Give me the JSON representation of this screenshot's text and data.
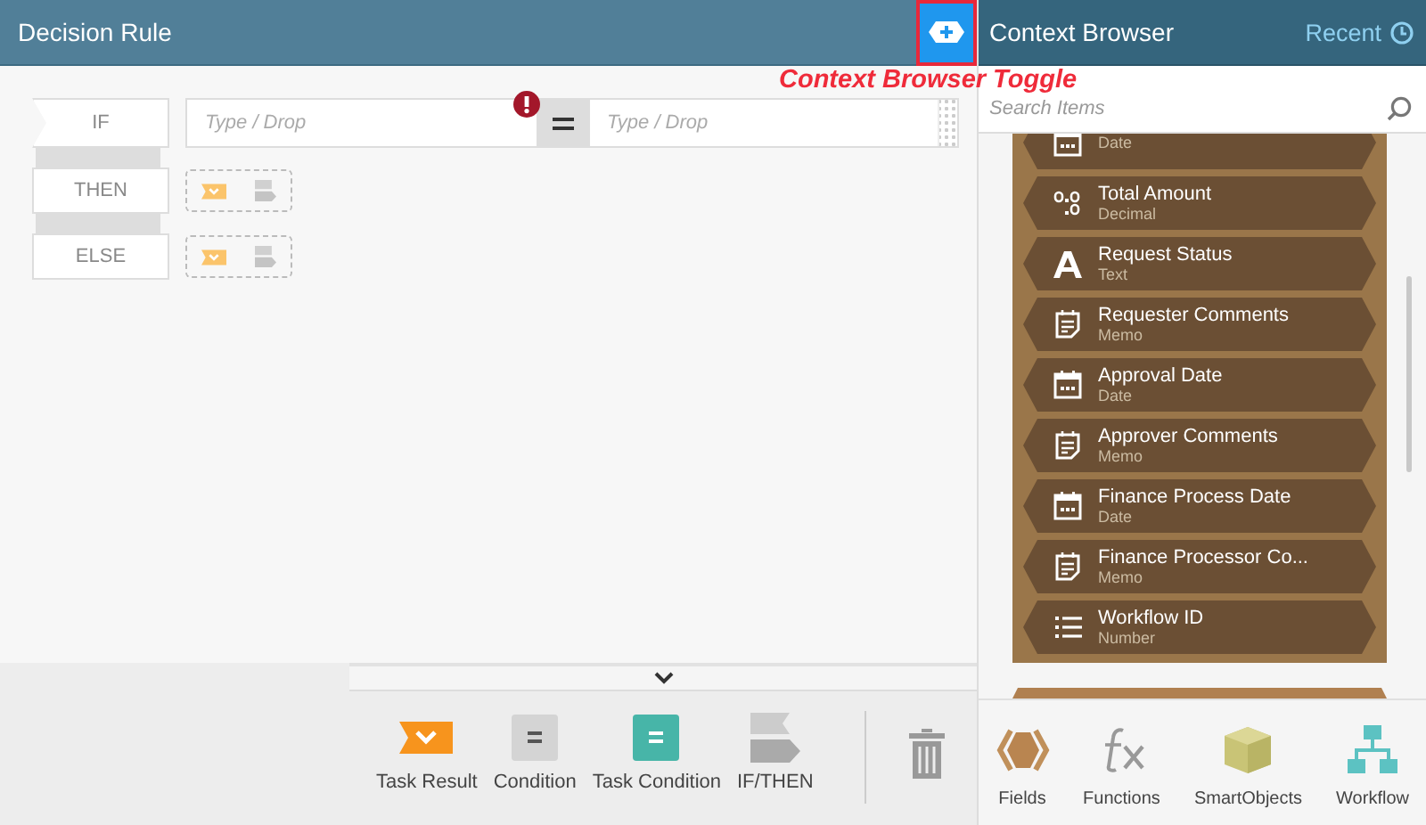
{
  "designer": {
    "title": "Decision Rule",
    "toggle_annotation": "Context Browser Toggle"
  },
  "rule": {
    "rows": [
      {
        "kind": "if",
        "label": "IF"
      },
      {
        "kind": "then",
        "label": "THEN"
      },
      {
        "kind": "else",
        "label": "ELSE"
      }
    ],
    "left_placeholder": "Type / Drop",
    "right_placeholder": "Type / Drop",
    "error": true
  },
  "toolbox": [
    {
      "kind": "task-result",
      "label": "Task Result"
    },
    {
      "kind": "condition",
      "label": "Condition"
    },
    {
      "kind": "task-condition",
      "label": "Task Condition"
    },
    {
      "kind": "if-then",
      "label": "IF/THEN"
    }
  ],
  "context_browser": {
    "title": "Context Browser",
    "recent": "Recent",
    "search": {
      "placeholder": "Search Items"
    },
    "items": [
      {
        "kind": "date",
        "type": "Date"
      },
      {
        "kind": "decimal",
        "name": "Total Amount",
        "type": "Decimal"
      },
      {
        "kind": "text",
        "name": "Request Status",
        "type": "Text"
      },
      {
        "kind": "memo",
        "name": "Requester Comments",
        "type": "Memo"
      },
      {
        "kind": "date",
        "name": "Approval Date",
        "type": "Date"
      },
      {
        "kind": "memo",
        "name": "Approver Comments",
        "type": "Memo"
      },
      {
        "kind": "date",
        "name": "Finance Process Date",
        "type": "Date"
      },
      {
        "kind": "memo",
        "name": "Finance Processor Co...",
        "type": "Memo"
      },
      {
        "kind": "number",
        "name": "Workflow ID",
        "type": "Number"
      }
    ],
    "tabs": [
      {
        "kind": "fields",
        "label": "Fields"
      },
      {
        "kind": "functions",
        "label": "Functions"
      },
      {
        "kind": "smartobjects",
        "label": "SmartObjects"
      },
      {
        "kind": "workflow",
        "label": "Workflow"
      }
    ]
  }
}
